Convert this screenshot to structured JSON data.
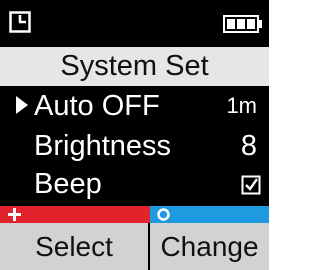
{
  "status_bar": {
    "left_icon": "clock-icon",
    "right_icon": "battery-full-icon"
  },
  "title": "System Set",
  "menu": {
    "items": [
      {
        "label": "Auto OFF",
        "value": "1m",
        "selected": true
      },
      {
        "label": "Brightness",
        "value": "8",
        "selected": false
      },
      {
        "label": "Beep",
        "value_icon": "checkbox-checked-icon",
        "checked": true,
        "selected": false
      }
    ]
  },
  "softkeys": {
    "left": {
      "label": "Select",
      "icon": "plus-icon",
      "color": "#e2232b"
    },
    "right": {
      "label": "Change",
      "icon": "circle-icon",
      "color": "#1e9ae0"
    }
  },
  "colors": {
    "display_bg": "#000000",
    "title_bg": "#e6e6e6",
    "softkey_bg": "#d2d2d2"
  }
}
